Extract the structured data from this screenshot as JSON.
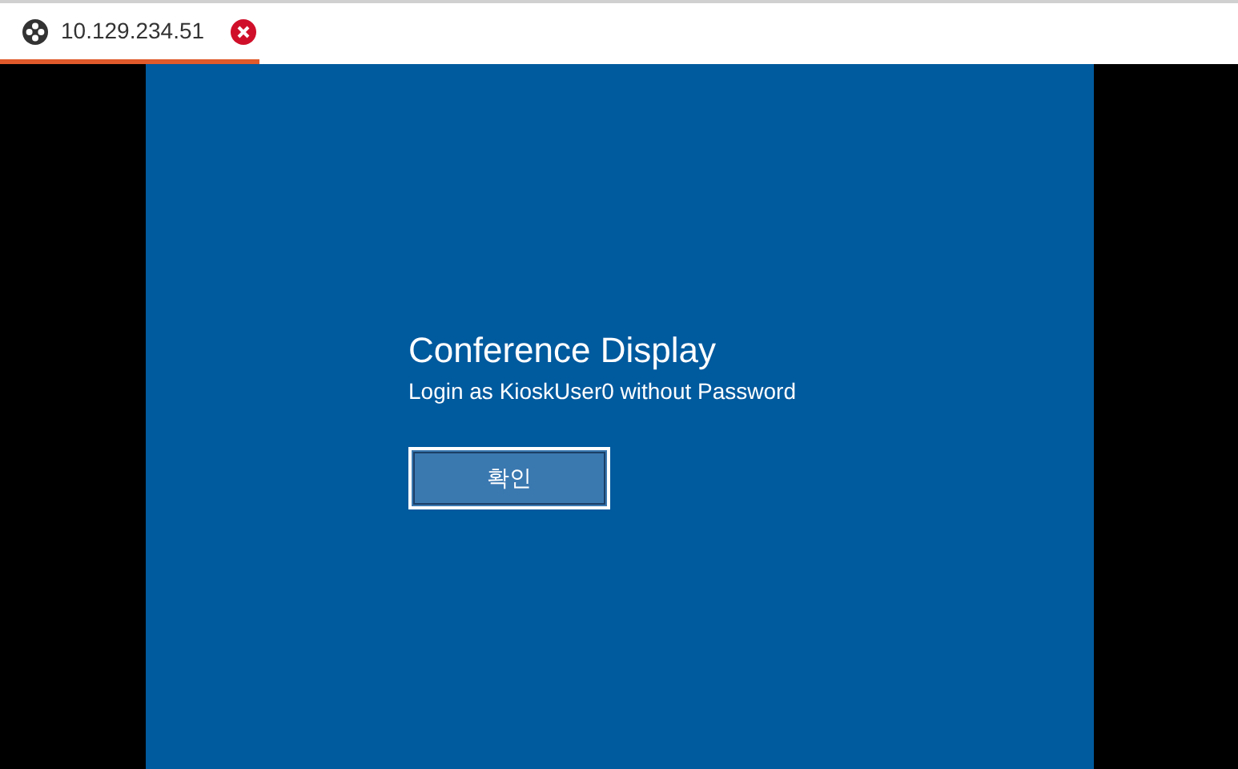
{
  "tabs": [
    {
      "label": "10.129.234.51",
      "selected": true
    }
  ],
  "screen": {
    "title": "Conference Display",
    "subtitle": "Login as KioskUser0 without Password",
    "button": "확인"
  }
}
